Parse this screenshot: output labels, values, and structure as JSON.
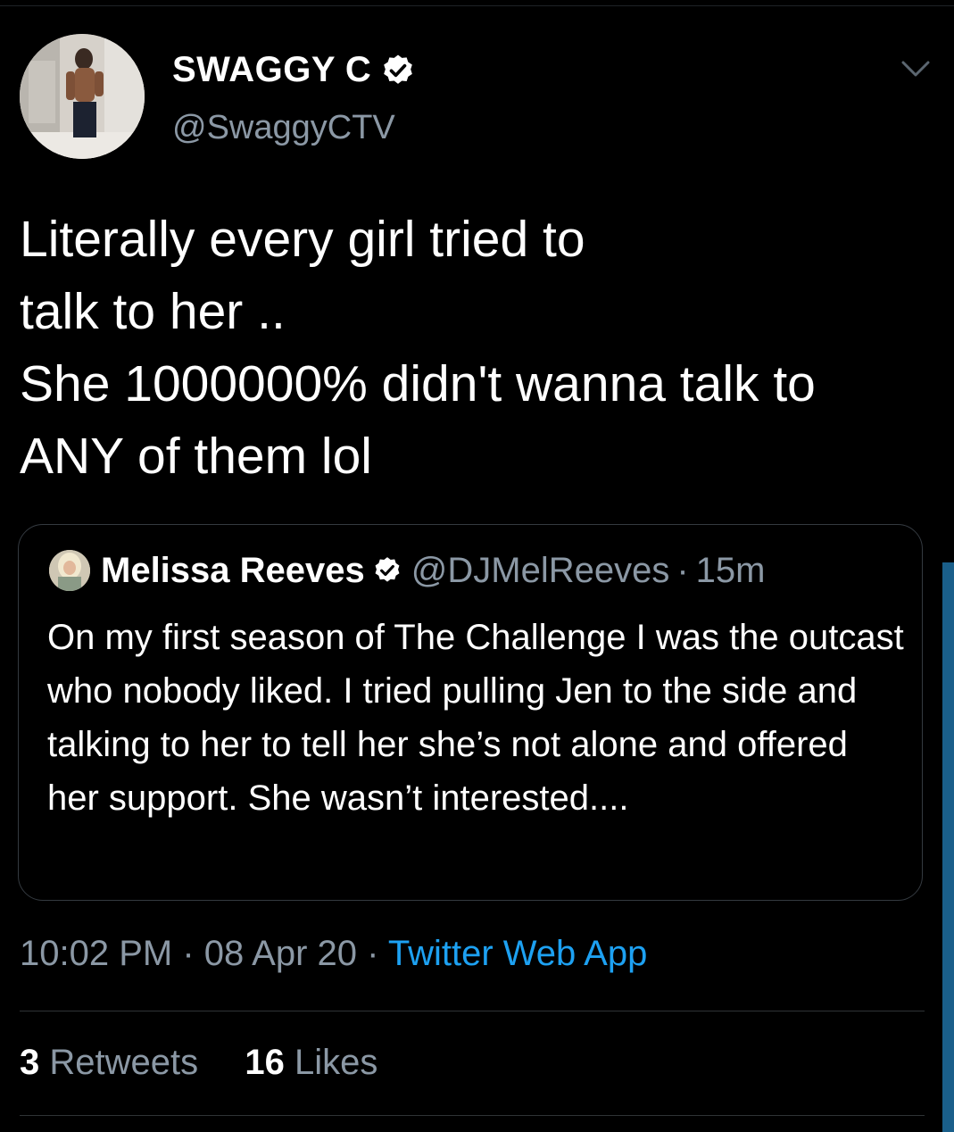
{
  "author": {
    "display_name": "SWAGGY C",
    "handle": "@SwaggyCTV",
    "verified": true
  },
  "tweet": {
    "text": "Literally every girl tried to\ntalk to her ..\nShe 1000000% didn't wanna talk to\nANY of them lol"
  },
  "quoted_tweet": {
    "display_name": "Melissa Reeves",
    "handle": "@DJMelReeves",
    "separator": "·",
    "time": "15m",
    "text": "On my first season of The Challenge I was the outcast who nobody liked. I tried pulling Jen to the side and talking to her to tell her she’s not alone and offered her support. She wasn’t interested...."
  },
  "meta": {
    "time": "10:02 PM",
    "sep1": " · ",
    "date": "08 Apr 20",
    "sep2": " · ",
    "source": "Twitter Web App"
  },
  "stats": {
    "retweets_count": "3",
    "retweets_label": "Retweets",
    "likes_count": "16",
    "likes_label": "Likes"
  },
  "colors": {
    "background": "#000000",
    "secondary_text": "#8b98a5",
    "link": "#1da1f2"
  },
  "icons": [
    "verified-badge-icon",
    "chevron-down-icon"
  ]
}
